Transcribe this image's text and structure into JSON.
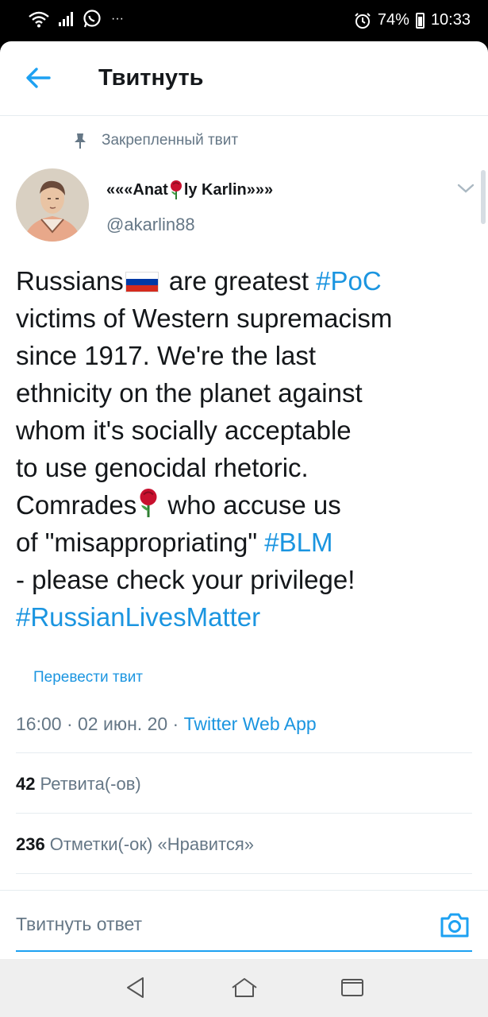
{
  "status_bar": {
    "battery": "74%",
    "time": "10:33",
    "overflow": "···"
  },
  "header": {
    "title": "Твитнуть"
  },
  "pinned": {
    "label": "Закрепленный твит"
  },
  "author": {
    "name_prefix": "«««Anat",
    "name_suffix": "ly Karlin»»»",
    "handle": "@akarlin88"
  },
  "tweet": {
    "lines": [
      {
        "a": "Russians",
        "b": " are greatest ",
        "tag": "#PoC"
      },
      {
        "text": "victims of Western supremacism"
      },
      {
        "text": "since 1917. We're the last"
      },
      {
        "text": "ethnicity on the planet against"
      },
      {
        "text": "whom it's socially acceptable"
      },
      {
        "text": "to use genocidal rhetoric."
      },
      {
        "a": "Comrades",
        "b": " who accuse us"
      },
      {
        "a": "of \"misappropriating\" ",
        "tag": "#BLM"
      },
      {
        "text": "- please check your privilege!"
      },
      {
        "tag": "#RussianLivesMatter"
      }
    ]
  },
  "translate_label": "Перевести твит",
  "meta": {
    "time": "16:00",
    "date": "02 июн. 20",
    "source": "Twitter Web App",
    "separator": " · "
  },
  "stats": {
    "retweets_count": "42",
    "retweets_label": "Ретвита(-ов)",
    "likes_count": "236",
    "likes_label": "Отметки(-ок) «Нравится»"
  },
  "reply": {
    "placeholder": "Твитнуть ответ"
  },
  "colors": {
    "accent": "#1da1f2",
    "link": "#1b95e0",
    "text": "#14171a",
    "secondary": "#657786"
  }
}
